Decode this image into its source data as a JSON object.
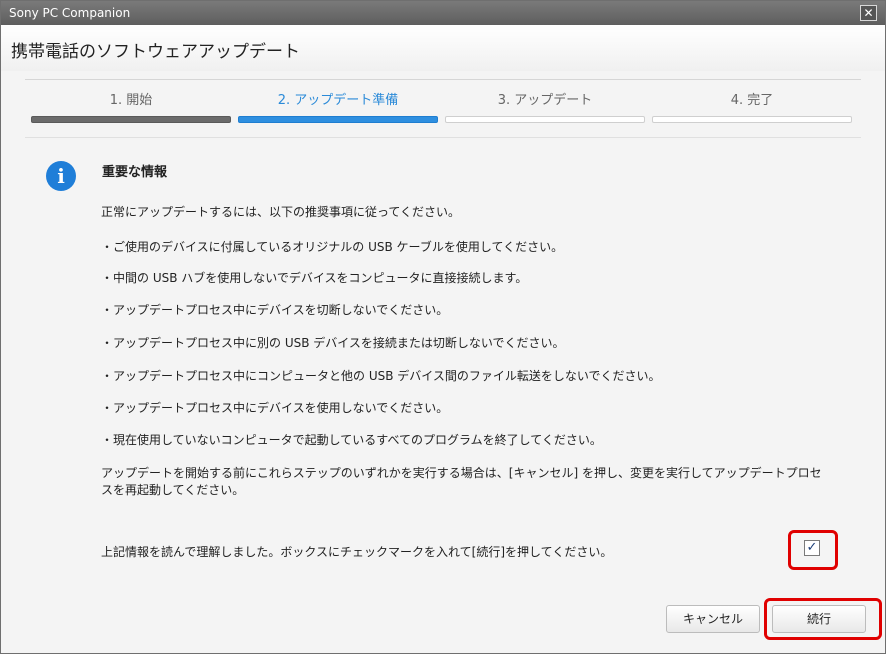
{
  "window": {
    "title": "Sony PC Companion"
  },
  "header": {
    "title": "携帯電話のソフトウェアアップデート"
  },
  "steps": [
    {
      "label": "1. 開始",
      "state": "done"
    },
    {
      "label": "2. アップデート準備",
      "state": "active"
    },
    {
      "label": "3. アップデート",
      "state": "pending"
    },
    {
      "label": "4. 完了",
      "state": "pending"
    }
  ],
  "info": {
    "heading": "重要な情報",
    "intro": "正常にアップデートするには、以下の推奨事項に従ってください。",
    "items": [
      "・ご使用のデバイスに付属しているオリジナルの USB ケーブルを使用してください。",
      "・中間の USB ハブを使用しないでデバイスをコンピュータに直接接続します。",
      "・アップデートプロセス中にデバイスを切断しないでください。",
      "・アップデートプロセス中に別の USB デバイスを接続または切断しないでください。",
      "・アップデートプロセス中にコンピュータと他の USB デバイス間のファイル転送をしないでください。",
      "・アップデートプロセス中にデバイスを使用しないでください。",
      "・現在使用していないコンピュータで起動しているすべてのプログラムを終了してください。"
    ],
    "note": "アップデートを開始する前にこれらステップのいずれかを実行する場合は、[キャンセル] を押し、変更を実行してアップデートプロセスを再起動してください。",
    "confirm": "上記情報を読んで理解しました。ボックスにチェックマークを入れて[続行]を押してください。"
  },
  "checkbox": {
    "checked": true,
    "mark": "✓"
  },
  "buttons": {
    "cancel": "キャンセル",
    "continue": "続行"
  },
  "icons": {
    "close": "close-icon",
    "info": "info-icon"
  },
  "colors": {
    "accent": "#2e8fe0",
    "highlight": "#e00000"
  }
}
